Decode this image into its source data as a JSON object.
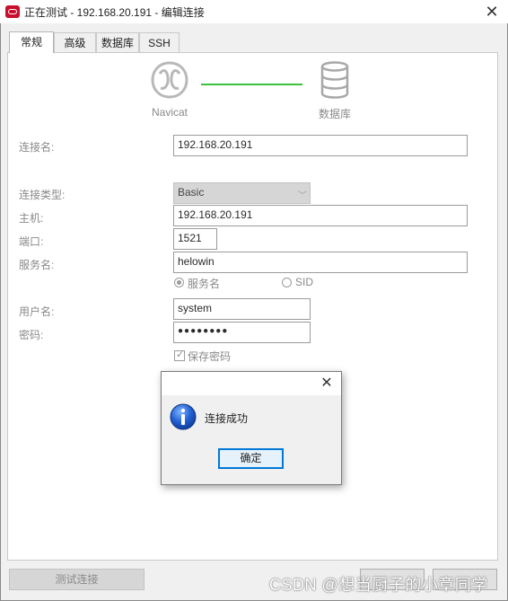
{
  "window": {
    "title": "正在测试 - 192.168.20.191 - 编辑连接",
    "close_glyph": "✕"
  },
  "tabs": [
    {
      "label": "常规",
      "active": true
    },
    {
      "label": "高级",
      "active": false
    },
    {
      "label": "数据库",
      "active": false
    },
    {
      "label": "SSH",
      "active": false
    }
  ],
  "graphic": {
    "left_label": "Navicat",
    "right_label": "数据库",
    "connector_color": "#3cc13c"
  },
  "form": {
    "connection_name_label": "连接名:",
    "connection_name_value": "192.168.20.191",
    "connection_type_label": "连接类型:",
    "connection_type_value": "Basic",
    "host_label": "主机:",
    "host_value": "192.168.20.191",
    "port_label": "端口:",
    "port_value": "1521",
    "service_name_label": "服务名:",
    "service_name_value": "helowin",
    "radio_service_name": "服务名",
    "radio_sid": "SID",
    "username_label": "用户名:",
    "username_value": "system",
    "password_label": "密码:",
    "password_value": "●●●●●●●●",
    "save_password_label": "保存密码"
  },
  "buttons": {
    "test_connection": "测试连接"
  },
  "dialog": {
    "close_glyph": "✕",
    "message": "连接成功",
    "confirm_label": "确定",
    "icon": "info-icon"
  },
  "watermark": "CSDN @想当厨子的小章同学"
}
